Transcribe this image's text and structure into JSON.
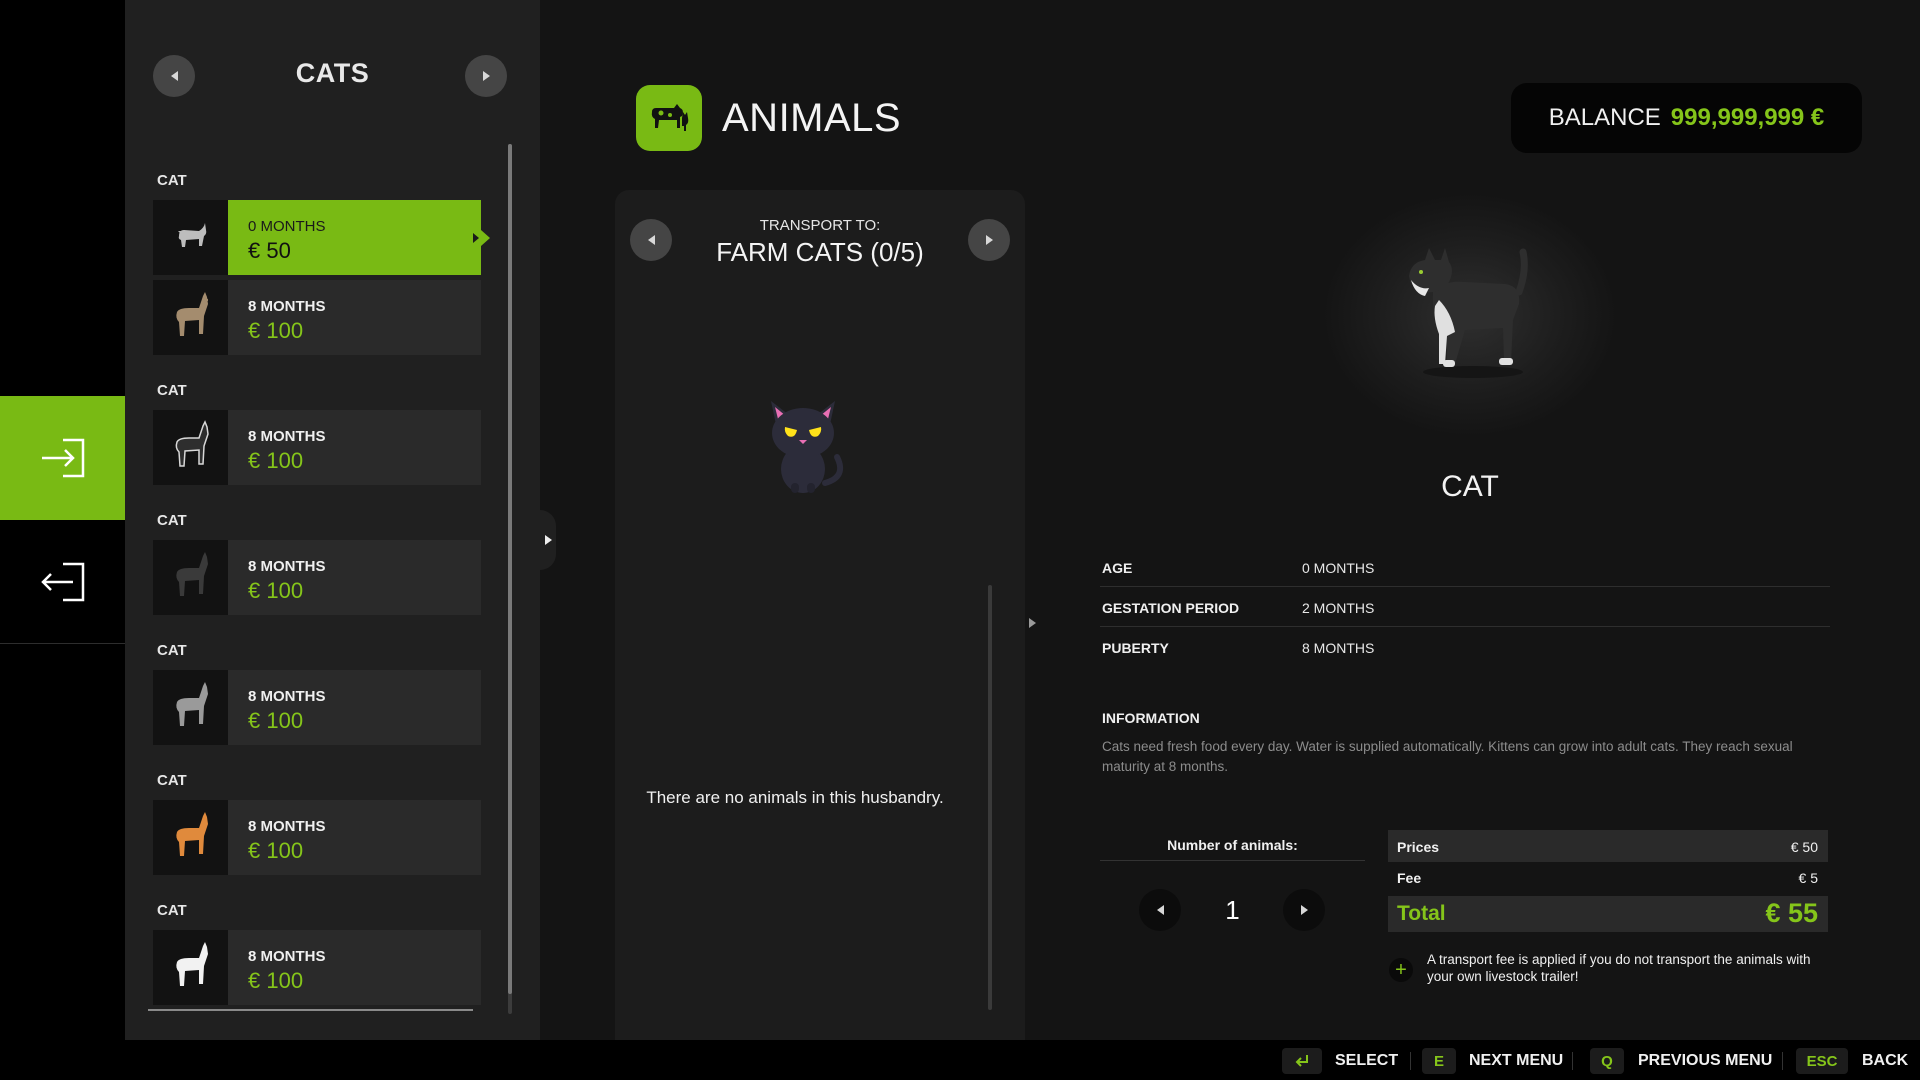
{
  "list": {
    "title": "CATS",
    "groups": [
      {
        "label": "CAT",
        "items": [
          {
            "age": "0 MONTHS",
            "price": "€ 50",
            "selected": true
          },
          {
            "age": "8 MONTHS",
            "price": "€ 100"
          }
        ]
      },
      {
        "label": "CAT",
        "items": [
          {
            "age": "8 MONTHS",
            "price": "€ 100"
          }
        ]
      },
      {
        "label": "CAT",
        "items": [
          {
            "age": "8 MONTHS",
            "price": "€ 100"
          }
        ]
      },
      {
        "label": "CAT",
        "items": [
          {
            "age": "8 MONTHS",
            "price": "€ 100"
          }
        ]
      },
      {
        "label": "CAT",
        "items": [
          {
            "age": "8 MONTHS",
            "price": "€ 100"
          }
        ]
      },
      {
        "label": "CAT",
        "items": [
          {
            "age": "8 MONTHS",
            "price": "€ 100"
          }
        ]
      }
    ]
  },
  "header": {
    "title": "ANIMALS",
    "balance_label": "BALANCE",
    "balance_value": "999,999,999 €"
  },
  "husbandry": {
    "transport_label": "TRANSPORT TO:",
    "transport_target": "FARM CATS (0/5)",
    "empty_message": "There are no animals in this husbandry."
  },
  "detail": {
    "name": "CAT",
    "attributes": [
      {
        "key": "AGE",
        "value": "0 MONTHS"
      },
      {
        "key": "GESTATION PERIOD",
        "value": "2 MONTHS"
      },
      {
        "key": "PUBERTY",
        "value": "8 MONTHS"
      }
    ],
    "info_heading": "INFORMATION",
    "info_text": "Cats need fresh food every day. Water is supplied automatically. Kittens can grow into adult cats. They reach sexual maturity at 8 months."
  },
  "purchase": {
    "quantity_label": "Number of animals:",
    "quantity": "1",
    "prices_label": "Prices",
    "prices_value": "€ 50",
    "fee_label": "Fee",
    "fee_value": "€ 5",
    "total_label": "Total",
    "total_value": "€ 55",
    "fee_note": "A transport fee is applied if you do not transport the animals with your own livestock trailer!"
  },
  "hotkeys": [
    {
      "key": "",
      "icon": "enter-key-icon",
      "label": "SELECT"
    },
    {
      "key": "E",
      "label": "NEXT MENU"
    },
    {
      "key": "Q",
      "label": "PREVIOUS MENU"
    },
    {
      "key": "ESC",
      "label": "BACK"
    }
  ],
  "colors": {
    "accent": "#79ba14",
    "accent_text": "#85c51a",
    "background": "#141414",
    "panel": "#202020"
  }
}
